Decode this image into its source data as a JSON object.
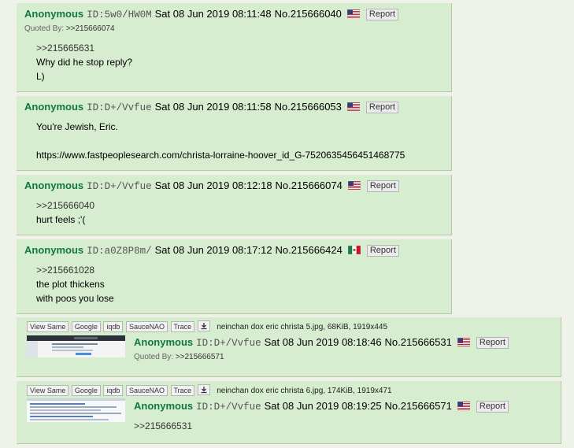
{
  "posts": [
    {
      "name": "Anonymous",
      "id": "ID:5w0/HW0M",
      "date": "Sat 08 Jun 2019 08:11:48",
      "no": "No.215666040",
      "flag": "us-flag-icon",
      "report": "Report",
      "quoted_by_label": "Quoted By:",
      "quoted_by": ">>215666074",
      "quote": ">>215665631",
      "body": "Why did he stop reply?\nL)"
    },
    {
      "name": "Anonymous",
      "id": "ID:D+/Vvfue",
      "date": "Sat 08 Jun 2019 08:11:58",
      "no": "No.215666053",
      "flag": "us-flag-icon",
      "report": "Report",
      "body": "You're Jewish, Eric.\n\nhttps://www.fastpeoplesearch.com/christa-lorraine-hoover_id_G-7520635456451468775"
    },
    {
      "name": "Anonymous",
      "id": "ID:D+/Vvfue",
      "date": "Sat 08 Jun 2019 08:12:18",
      "no": "No.215666074",
      "flag": "us-flag-icon",
      "report": "Report",
      "quote": ">>215666040",
      "body": "hurt feels ;'("
    },
    {
      "name": "Anonymous",
      "id": "ID:a0Z8P8m/",
      "date": "Sat 08 Jun 2019 08:17:12",
      "no": "No.215666424",
      "flag": "mx-flag-icon",
      "report": "Report",
      "quote": ">>215661028",
      "body": "the plot thickens\nwith poos you lose"
    },
    {
      "name": "Anonymous",
      "id": "ID:D+/Vvfue",
      "date": "Sat 08 Jun 2019 08:18:46",
      "no": "No.215666531",
      "flag": "us-flag-icon",
      "report": "Report",
      "file_info": "neinchan dox eric christa 5.jpg, 68KiB, 1919x445",
      "quoted_by_label": "Quoted By:",
      "quoted_by": ">>215666571"
    },
    {
      "name": "Anonymous",
      "id": "ID:D+/Vvfue",
      "date": "Sat 08 Jun 2019 08:19:25",
      "no": "No.215666571",
      "flag": "us-flag-icon",
      "report": "Report",
      "file_info": "neinchan dox eric christa 6.jpg, 174KiB, 1919x471",
      "quote": ">>215666531"
    }
  ],
  "image_tools": [
    "View Same",
    "Google",
    "iqdb",
    "SauceNAO",
    "Trace"
  ],
  "colors": {
    "background": "#eef2e9",
    "post_bg": "#d6edcf",
    "name": "#117743",
    "border": "#b7c5a8"
  }
}
